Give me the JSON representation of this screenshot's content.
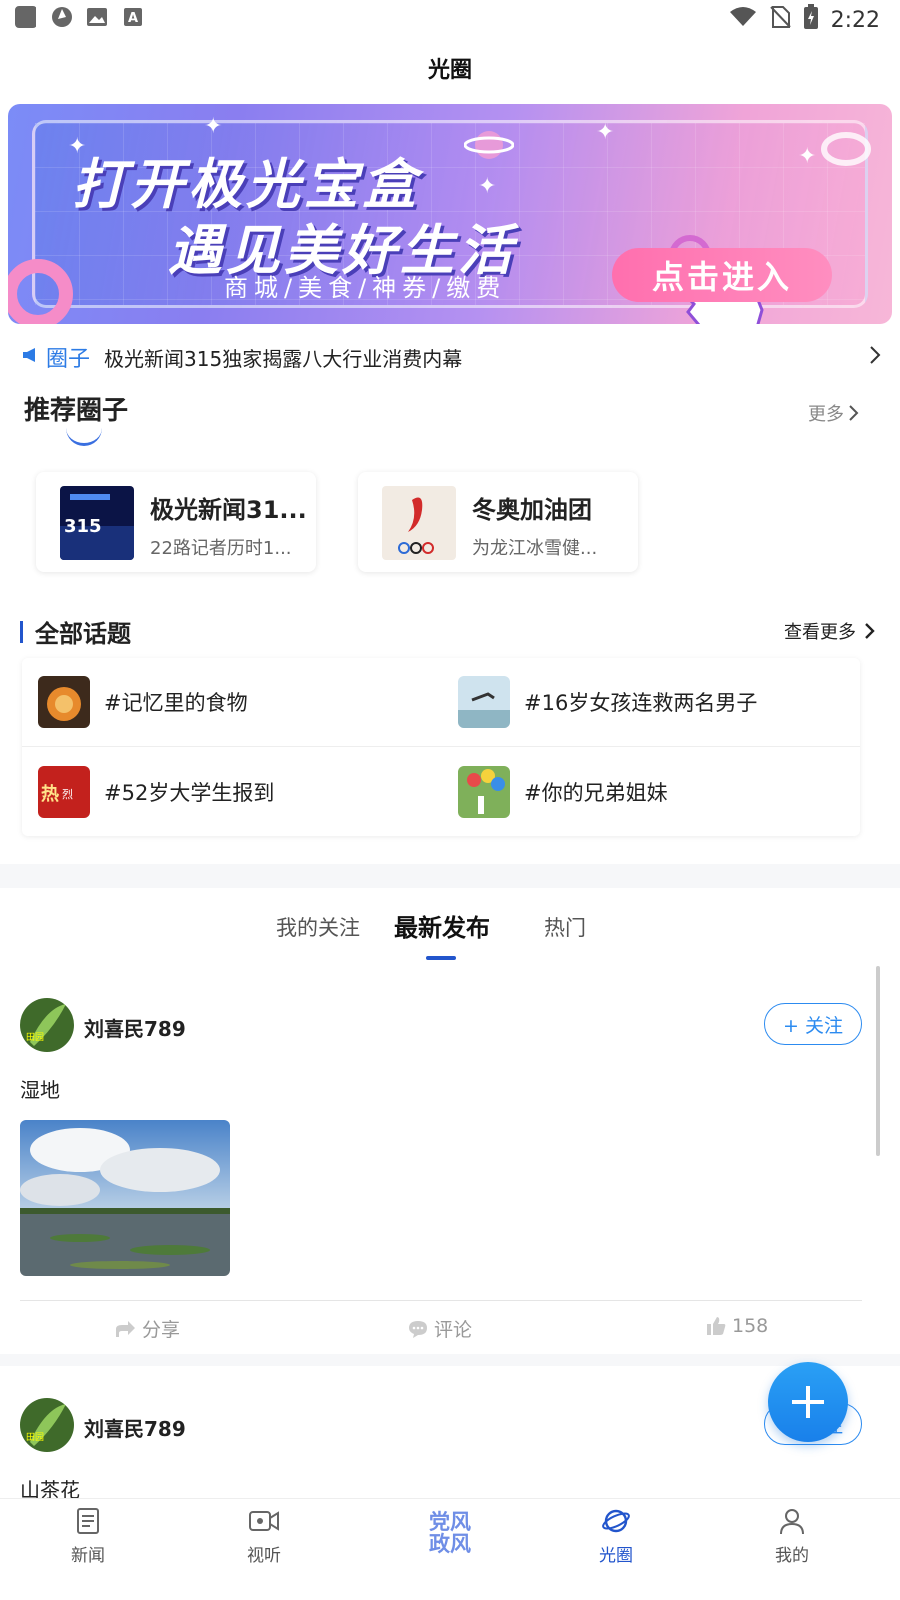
{
  "status_bar": {
    "time": "2:22"
  },
  "header": {
    "title": "光圈"
  },
  "banner": {
    "line1": "打开极光宝盒",
    "line2": "遇见美好生活",
    "subtitle": "商城/美食/神券/缴费",
    "cta": "点击进入"
  },
  "notice": {
    "tag": "圈子",
    "text": "极光新闻315独家揭露八大行业消费内幕"
  },
  "recommended": {
    "title": "推荐圈子",
    "more": "更多",
    "cards": [
      {
        "name": "极光新闻31...",
        "desc": "22路记者历时1..."
      },
      {
        "name": "冬奥加油团",
        "desc": "为龙江冰雪健..."
      }
    ]
  },
  "topics": {
    "title": "全部话题",
    "more": "查看更多",
    "items": [
      {
        "label": "#记忆里的食物"
      },
      {
        "label": "#16岁女孩连救两名男子"
      },
      {
        "label": "#52岁大学生报到"
      },
      {
        "label": "#你的兄弟姐妹"
      }
    ]
  },
  "feed_tabs": [
    {
      "label": "我的关注"
    },
    {
      "label": "最新发布"
    },
    {
      "label": "热门"
    }
  ],
  "posts": [
    {
      "user": "刘喜民789",
      "follow": "+ 关注",
      "text": "湿地",
      "share": "分享",
      "comment": "评论",
      "likes": "158"
    },
    {
      "user": "刘喜民789",
      "follow": "+ 关注",
      "text": "山茶花"
    }
  ],
  "bottom_nav": [
    {
      "label": "新闻"
    },
    {
      "label": "视听"
    },
    {
      "label": "党风\n政风"
    },
    {
      "label": "光圈"
    },
    {
      "label": "我的"
    }
  ]
}
